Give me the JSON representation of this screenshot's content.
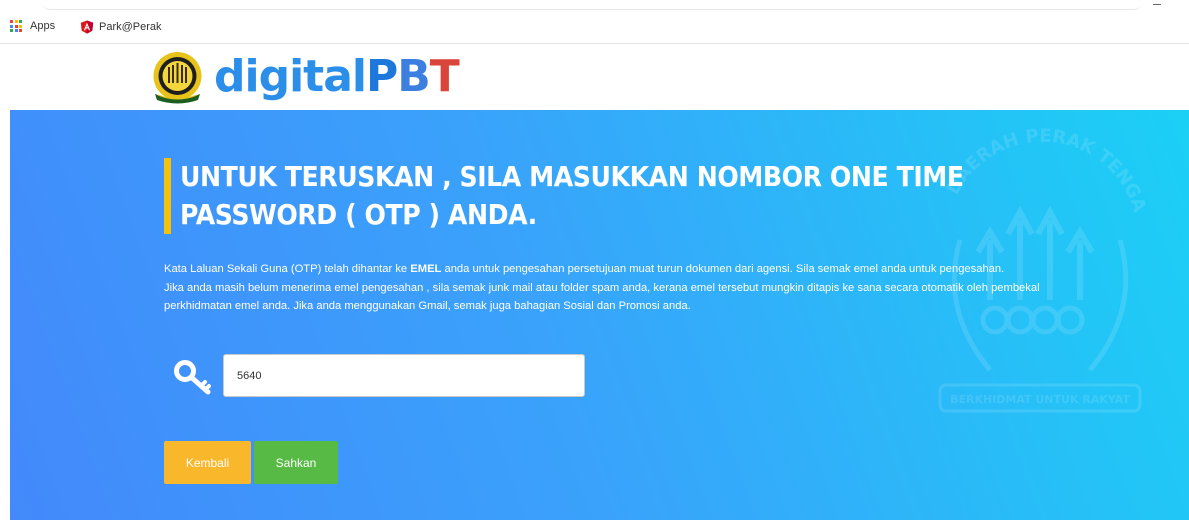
{
  "bookmarks": {
    "items": [
      {
        "label": "Apps",
        "icon": "apps-grid-icon"
      },
      {
        "label": "Park@Perak",
        "icon": "angular-icon"
      }
    ]
  },
  "logo": {
    "part1": "digital",
    "part2": "P",
    "part3": "B",
    "part4": "T"
  },
  "page": {
    "heading": "UNTUK TERUSKAN , SILA MASUKKAN NOMBOR ONE TIME PASSWORD ( OTP ) ANDA.",
    "desc_line1_pre": "Kata Laluan Sekali Guna (OTP) telah dihantar ke ",
    "desc_line1_bold": "EMEL",
    "desc_line1_post": " anda untuk pengesahan persetujuan muat turun dokumen dari agensi. Sila semak emel anda untuk pengesahan.",
    "desc_line2": "Jika anda masih belum menerima emel pengesahan , sila semak junk mail atau folder spam anda, kerana emel tersebut mungkin ditapis ke sana secara otomatik oleh pembekal perkhidmatan emel anda. Jika anda menggunakan Gmail, semak juga bahagian Sosial dan Promosi anda.",
    "otp_value": "5640",
    "back_label": "Kembali",
    "confirm_label": "Sahkan"
  },
  "watermark": {
    "top_text": "DAERAH PERAK TENGAH",
    "bottom_text": "BERKHIDMAT UNTUK RAKYAT"
  },
  "colors": {
    "accent_yellow": "#f4c20d",
    "button_back": "#f9b82b",
    "button_confirm": "#56ba44",
    "hero_start": "#4389fb",
    "hero_end": "#1bd0f5"
  }
}
